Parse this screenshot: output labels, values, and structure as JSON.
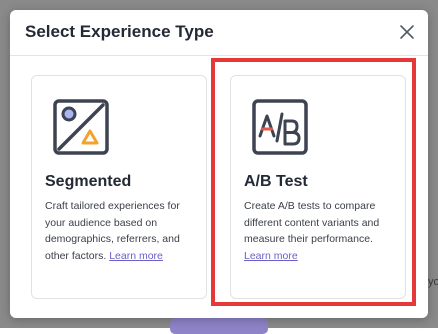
{
  "modal": {
    "title": "Select Experience Type"
  },
  "cards": {
    "segmented": {
      "icon": "segmented-icon",
      "title": "Segmented",
      "description": "Craft tailored experiences for your audience based on demographics, referrers, and other factors.",
      "link": "Learn more"
    },
    "ab_test": {
      "icon": "ab-test-icon",
      "title": "A/B Test",
      "description": "Create A/B tests to compare different content variants and measure their performance.",
      "link": "Learn more",
      "highlighted": true
    }
  },
  "background_fragment": "yo",
  "colors": {
    "highlight": "#e53838",
    "link": "#6b5fc8",
    "circle_fill": "#a9b5f0",
    "triangle_stroke": "#f0a42a",
    "icon_stroke": "#3d4350"
  }
}
